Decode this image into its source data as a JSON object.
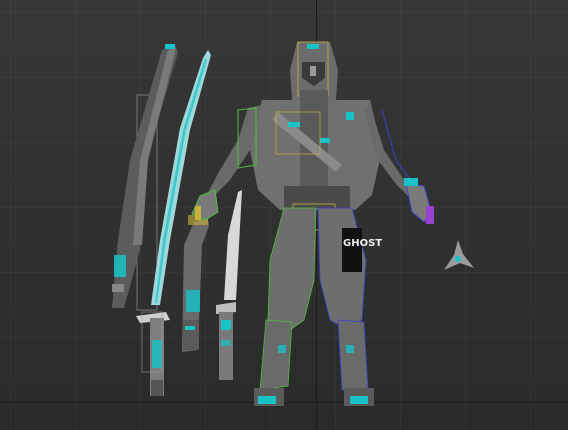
{
  "scene": {
    "emblem_text": "GHOST",
    "colors": {
      "background": "#303030",
      "grid": "#444444",
      "axis": "#1c1c1c",
      "body": "#6e6e6e",
      "body_dark": "#4a4a4a",
      "accent": "#17c3c9",
      "select_green": "#4cbf3a",
      "select_blue": "#3a3fd0",
      "select_yellow": "#c9b23a",
      "select_purple": "#9a3fd0"
    },
    "objects": [
      "sheath-long",
      "katana-blade",
      "short-sheath",
      "short-blade",
      "character",
      "shuriken"
    ]
  }
}
